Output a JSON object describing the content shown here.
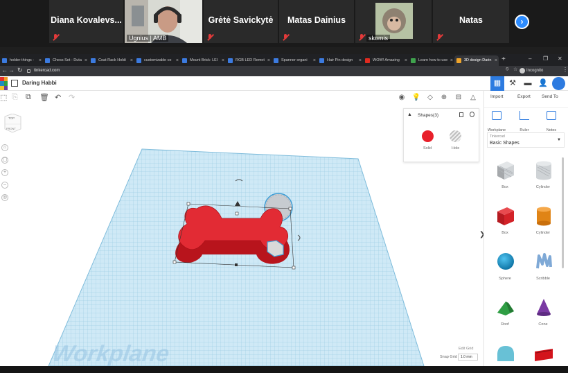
{
  "zoom": {
    "participants": [
      {
        "name": "Diana  Kovalevs...",
        "muted": true
      },
      {
        "name": "",
        "camera_label": "Ugnius | AMB",
        "video": true
      },
      {
        "name": "Grėtė Savickytė",
        "muted": true
      },
      {
        "name": "Matas Dainius",
        "muted": true
      },
      {
        "name": "",
        "camera_label": "skomis",
        "video": true,
        "muted": true
      },
      {
        "name": "Natas",
        "muted": true
      }
    ]
  },
  "browser": {
    "tabs": [
      "holder-things -",
      "Chess Set - Duta",
      "Coat Rack Holdi",
      "customizable co",
      "Mount Brick: LEI",
      "RGB LED Remot",
      "Spanner organi",
      "Hair Pin design",
      "WOW! Amazing",
      "Learn how to use",
      "3D design Darin"
    ],
    "url": "tinkercad.com",
    "profile": "Incognito"
  },
  "tinkercad": {
    "design_title": "Daring Habbi",
    "actions": {
      "import": "Import",
      "export": "Export",
      "send_to": "Send To"
    },
    "tools": {
      "workplane": "Workplane",
      "ruler": "Ruler",
      "notes": "Notes"
    },
    "library": {
      "source": "Tinkercad",
      "selected": "Basic Shapes"
    },
    "shapes": [
      {
        "label": "Box",
        "kind": "box-hole"
      },
      {
        "label": "Cylinder",
        "kind": "cyl-hole"
      },
      {
        "label": "Box",
        "kind": "box"
      },
      {
        "label": "Cylinder",
        "kind": "cylinder"
      },
      {
        "label": "Sphere",
        "kind": "sphere"
      },
      {
        "label": "Scribble",
        "kind": "scribble"
      },
      {
        "label": "Roof",
        "kind": "roof"
      },
      {
        "label": "Cone",
        "kind": "cone"
      },
      {
        "label": "",
        "kind": "round-roof"
      },
      {
        "label": "",
        "kind": "text"
      }
    ],
    "shapes_panel": {
      "title": "Shapes(3)",
      "solid": "Solid",
      "hole": "Hole"
    },
    "viewcube": {
      "top": "TOP",
      "front": "FRONT"
    },
    "workplane_label": "Workplane",
    "edit_grid": "Edit Grid",
    "snap_grid": {
      "label": "Snap Grid",
      "value": "1.0 mm"
    }
  },
  "colors": {
    "accent": "#2d7be0",
    "solid": "#e8202a",
    "grid": "#a8d8ee"
  }
}
